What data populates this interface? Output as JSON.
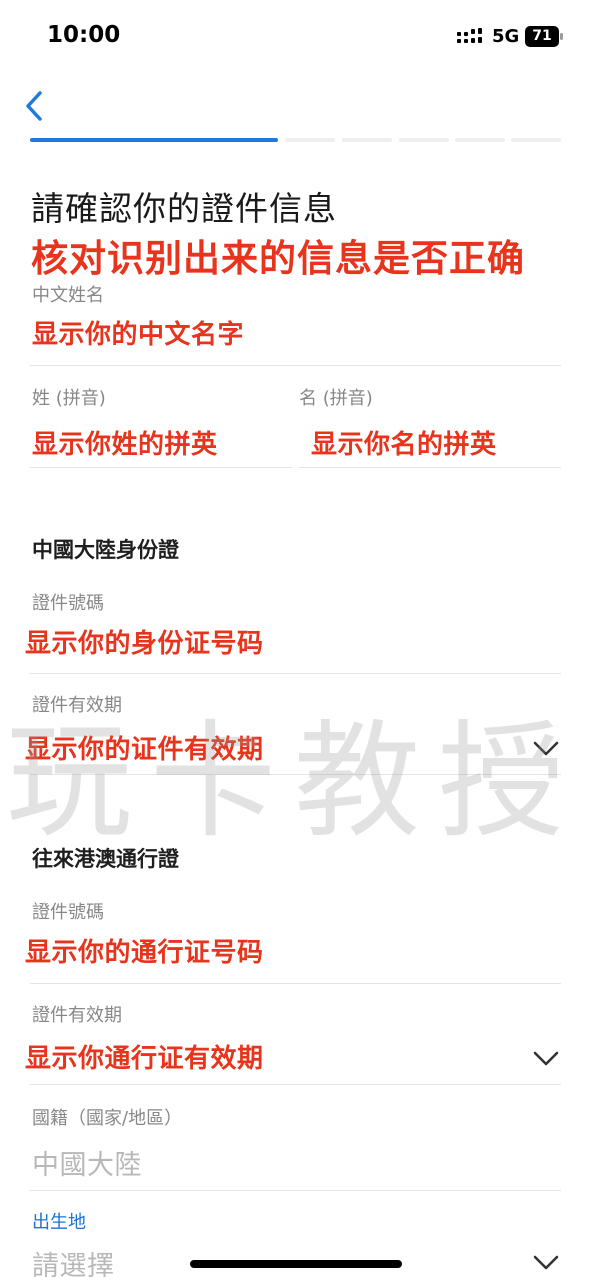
{
  "status_bar": {
    "time": "10:00",
    "network": "5G",
    "battery": "71",
    "icons": [
      "signal-icon",
      "battery-icon"
    ]
  },
  "nav": {
    "back_icon": "chevron-left-icon",
    "progress": {
      "total_steps": 6,
      "current_step": 1
    }
  },
  "header": {
    "title": "請確認你的證件信息",
    "annotation": "核对识别出来的信息是否正确"
  },
  "name_section": {
    "chinese_name": {
      "label": "中文姓名",
      "value": "显示你的中文名字"
    },
    "surname": {
      "label": "姓 (拼音)",
      "value": "显示你姓的拼英"
    },
    "given_name": {
      "label": "名 (拼音)",
      "value": "显示你名的拼英"
    }
  },
  "id_card_section": {
    "heading": "中國大陸身份證",
    "number": {
      "label": "證件號碼",
      "value": "显示你的身份证号码"
    },
    "expiry": {
      "label": "證件有效期",
      "value": "显示你的证件有效期"
    }
  },
  "permit_section": {
    "heading": "往來港澳通行證",
    "number": {
      "label": "證件號碼",
      "value": "显示你的通行证号码"
    },
    "expiry": {
      "label": "證件有效期",
      "value": "显示你通行证有效期"
    }
  },
  "nationality": {
    "label": "國籍（國家/地區）",
    "value": "中國大陸"
  },
  "birthplace": {
    "label": "出生地",
    "placeholder": "請選擇"
  },
  "watermark": "玩卡教授",
  "colors": {
    "accent": "#1f7ae0",
    "annotation_red": "#e8341c",
    "label_gray": "#888888",
    "placeholder_gray": "#b8b8b8"
  }
}
